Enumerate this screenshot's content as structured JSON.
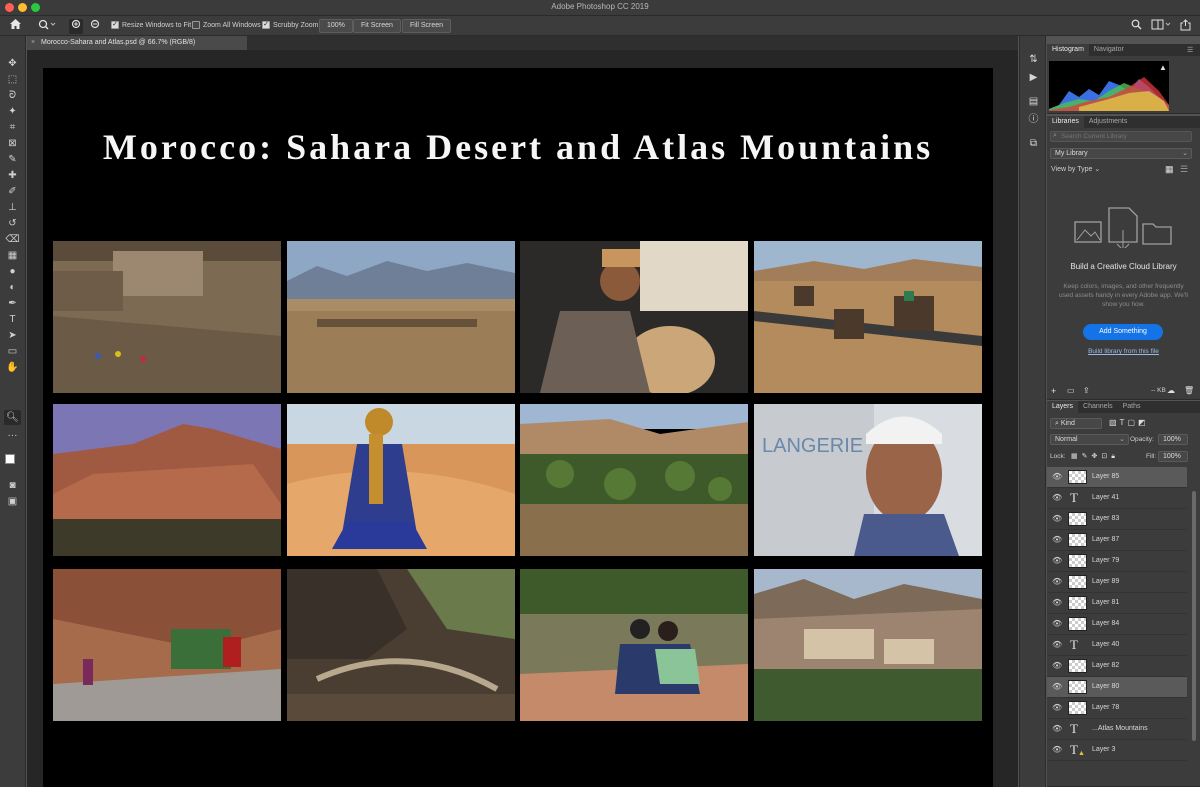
{
  "window": {
    "title": "Adobe Photoshop CC 2019"
  },
  "options_bar": {
    "home_icon": "home-icon",
    "zoom_tool_icon": "magnifier-icon",
    "zoom_in_icon": "zoom-in-icon",
    "zoom_out_icon": "zoom-out-icon",
    "resize_windows_label": "Resize Windows to Fit",
    "resize_windows_checked": true,
    "zoom_all_label": "Zoom All Windows",
    "zoom_all_checked": false,
    "scrubby_zoom_label": "Scrubby Zoom",
    "scrubby_zoom_checked": true,
    "zoom_100_label": "100%",
    "fit_screen_label": "Fit Screen",
    "fill_screen_label": "Fill Screen"
  },
  "document": {
    "tab_label": "Morocco-Sahara and Atlas.psd @ 66.7% (RGB/8)",
    "headline": "Morocco: Sahara Desert and Atlas Mountains",
    "photos": [
      "stone-village",
      "caravan-plain",
      "man-with-sheep",
      "mule-caravan",
      "kasbah-village",
      "blue-turban-dunes",
      "palm-oasis",
      "lingerie-man",
      "truck-road",
      "gorge-trail",
      "women-reading",
      "mountain-village"
    ]
  },
  "histogram_panel": {
    "tabs": [
      "Histogram",
      "Navigator"
    ],
    "active_tab": 0
  },
  "libraries_panel": {
    "tabs": [
      "Libraries",
      "Adjustments"
    ],
    "active_tab": 0,
    "search_placeholder": "Search Current Library",
    "library_select": "My Library",
    "view_by": "View by Type",
    "empty_title": "Build a Creative Cloud Library",
    "empty_desc": "Keep colors, images, and other frequently used assets handy in every Adobe app. We'll show you how.",
    "add_button": "Add Something",
    "build_link": "Build library from this file",
    "size_label": "-- KB"
  },
  "layers_panel": {
    "tabs": [
      "Layers",
      "Channels",
      "Paths"
    ],
    "active_tab": 0,
    "filter_kind": "Kind",
    "blend_mode": "Normal",
    "opacity_label": "Opacity:",
    "opacity_value": "100%",
    "lock_label": "Lock:",
    "fill_label": "Fill:",
    "fill_value": "100%",
    "layers": [
      {
        "name": "Layer 85",
        "type": "pixel",
        "selected": true
      },
      {
        "name": "Layer 41",
        "type": "text",
        "selected": false
      },
      {
        "name": "Layer 83",
        "type": "pixel",
        "selected": false
      },
      {
        "name": "Layer 87",
        "type": "pixel",
        "selected": false
      },
      {
        "name": "Layer 79",
        "type": "pixel",
        "selected": false
      },
      {
        "name": "Layer 89",
        "type": "pixel",
        "selected": false
      },
      {
        "name": "Layer 81",
        "type": "pixel",
        "selected": false
      },
      {
        "name": "Layer 84",
        "type": "pixel",
        "selected": false
      },
      {
        "name": "Layer 40",
        "type": "text",
        "selected": false
      },
      {
        "name": "Layer 82",
        "type": "pixel",
        "selected": false
      },
      {
        "name": "Layer 80",
        "type": "pixel",
        "selected": true
      },
      {
        "name": "Layer 78",
        "type": "pixel",
        "selected": false
      },
      {
        "name": "...Atlas Mountains",
        "type": "text",
        "selected": false
      },
      {
        "name": "Layer 3",
        "type": "text-warning",
        "selected": false
      }
    ]
  },
  "colors": {
    "app_bg": "#535353",
    "panel_bg": "#3c3c3c",
    "accent_blue": "#1473e6",
    "artboard": "#000000"
  }
}
